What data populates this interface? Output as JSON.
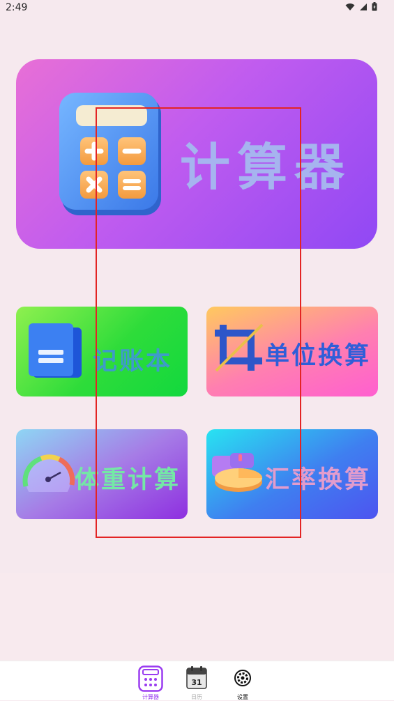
{
  "status": {
    "time": "2:49"
  },
  "hero": {
    "title": "计算器"
  },
  "tiles": [
    {
      "label": "记账本"
    },
    {
      "label": "单位换算"
    },
    {
      "label": "体重计算"
    },
    {
      "label": "汇率换算"
    }
  ],
  "tabs": [
    {
      "label": "计算器",
      "active": true,
      "icon": "calculator-icon"
    },
    {
      "label": "日历",
      "active": false,
      "icon": "calendar-icon",
      "day": "31"
    },
    {
      "label": "设置",
      "active": false,
      "icon": "gear-icon"
    }
  ],
  "colors": {
    "accent": "#9a3cf0",
    "highlight_box": "#e32424"
  }
}
